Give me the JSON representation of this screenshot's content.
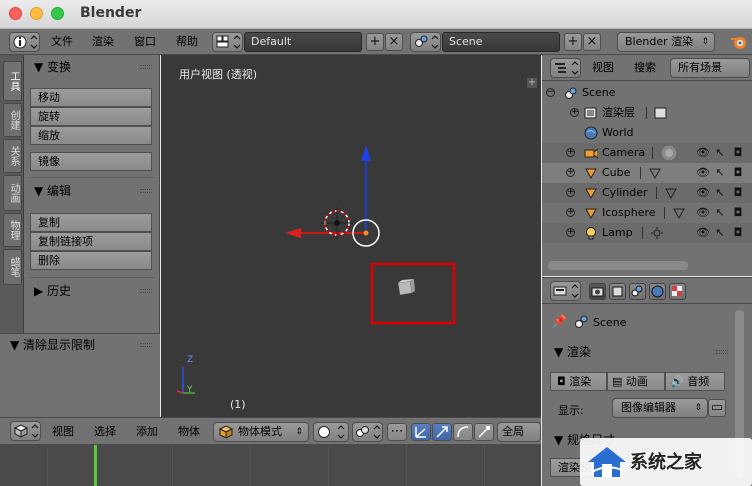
{
  "window": {
    "title": "Blender"
  },
  "info_header": {
    "menus": [
      "文件",
      "渲染",
      "窗口",
      "帮助"
    ],
    "screen_layout": "Default",
    "scene": "Scene",
    "render_engine": "Blender 渲染"
  },
  "tool_shelf": {
    "tabs": [
      "工具",
      "创建",
      "关系",
      "动画",
      "物理",
      "蜡笔"
    ],
    "panels": {
      "transform": {
        "title": "变换",
        "buttons": [
          "移动",
          "旋转",
          "缩放",
          "镜像"
        ]
      },
      "edit": {
        "title": "编辑",
        "buttons": [
          "复制",
          "复制链接项",
          "删除"
        ]
      },
      "history": {
        "title": "历史"
      },
      "operator": {
        "title": "清除显示限制"
      }
    }
  },
  "viewport": {
    "view_label": "用户视图 (透视)",
    "frame_label": "(1)",
    "axis_labels": {
      "z": "Z",
      "y": "Y"
    },
    "highlight_color": "#e00000"
  },
  "viewport_header": {
    "menus": [
      "视图",
      "选择",
      "添加",
      "物体"
    ],
    "mode": "物体模式",
    "orientation": "全局"
  },
  "outliner": {
    "menus": [
      "视图",
      "搜索"
    ],
    "filter": "所有场景",
    "items": [
      {
        "name": "Scene",
        "icon": "scene-icon"
      },
      {
        "name": "渲染层",
        "icon": "render-layers-icon"
      },
      {
        "name": "World",
        "icon": "world-icon"
      },
      {
        "name": "Camera",
        "icon": "camera-icon"
      },
      {
        "name": "Cube",
        "icon": "mesh-icon"
      },
      {
        "name": "Cylinder",
        "icon": "mesh-icon"
      },
      {
        "name": "Icosphere",
        "icon": "mesh-icon"
      },
      {
        "name": "Lamp",
        "icon": "lamp-icon"
      }
    ]
  },
  "properties": {
    "context": "Scene",
    "render_panel": {
      "title": "渲染",
      "buttons": [
        "渲染",
        "动画",
        "音频"
      ],
      "display_label": "显示:",
      "display_value": "图像编辑器"
    },
    "dimensions_panel": {
      "title": "规格尺寸"
    },
    "preset_label": "渲染预"
  },
  "watermark": {
    "text": "系统之家"
  }
}
